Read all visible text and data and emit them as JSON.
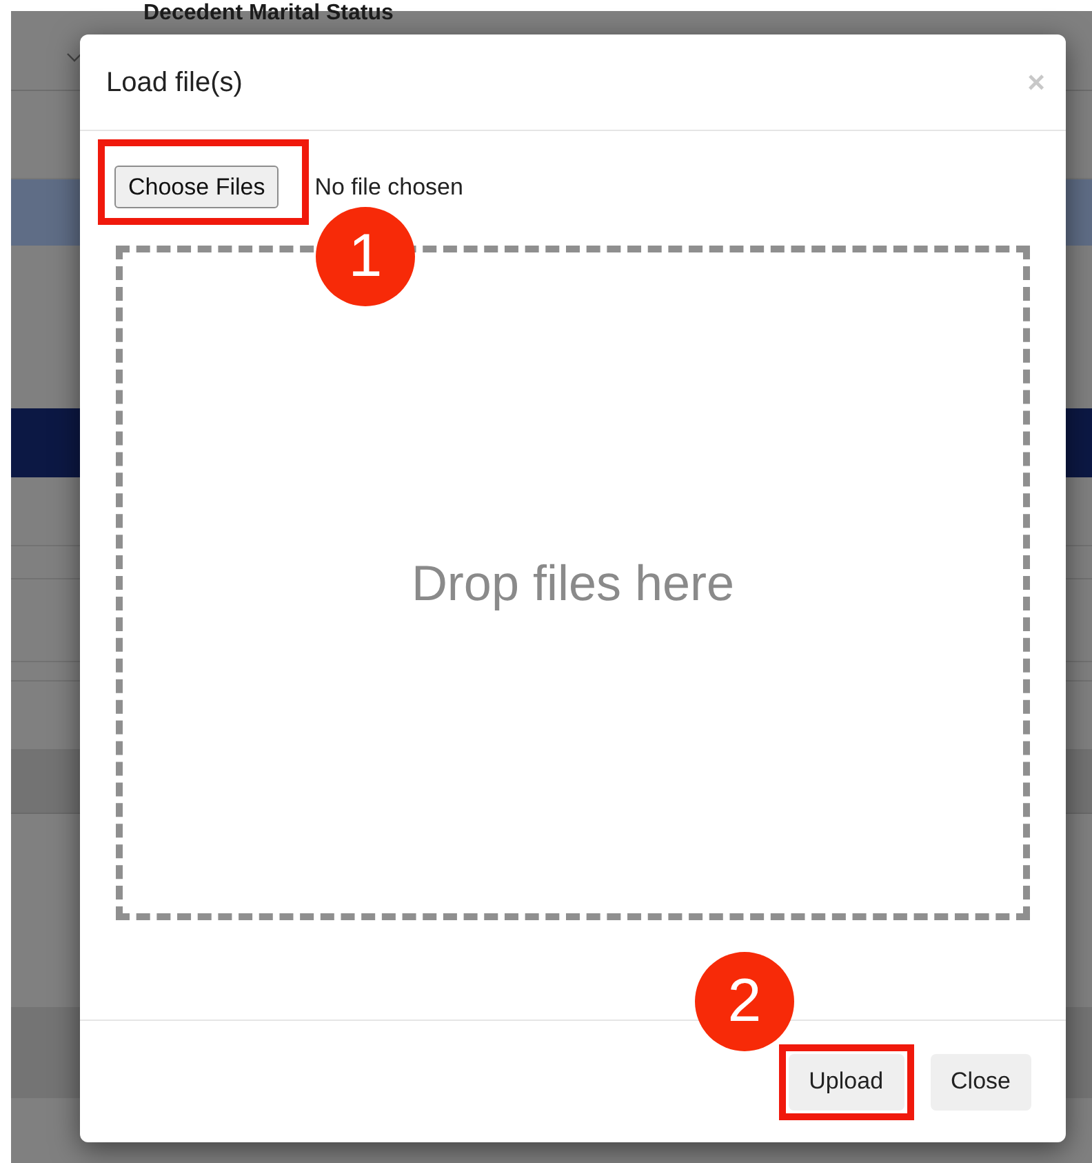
{
  "background_page": {
    "section_title": "Decedent Marital Status"
  },
  "dialog": {
    "title": "Load file(s)",
    "close_icon": "×",
    "file_input": {
      "button": "Choose Files",
      "status": "No file chosen"
    },
    "drop_zone": {
      "text": "Drop files here"
    },
    "buttons": [
      {
        "label": "Upload",
        "highlighted": true
      },
      {
        "label": "Close",
        "highlighted": false
      }
    ]
  },
  "callouts": [
    {
      "number": "1"
    },
    {
      "number": "2"
    }
  ]
}
